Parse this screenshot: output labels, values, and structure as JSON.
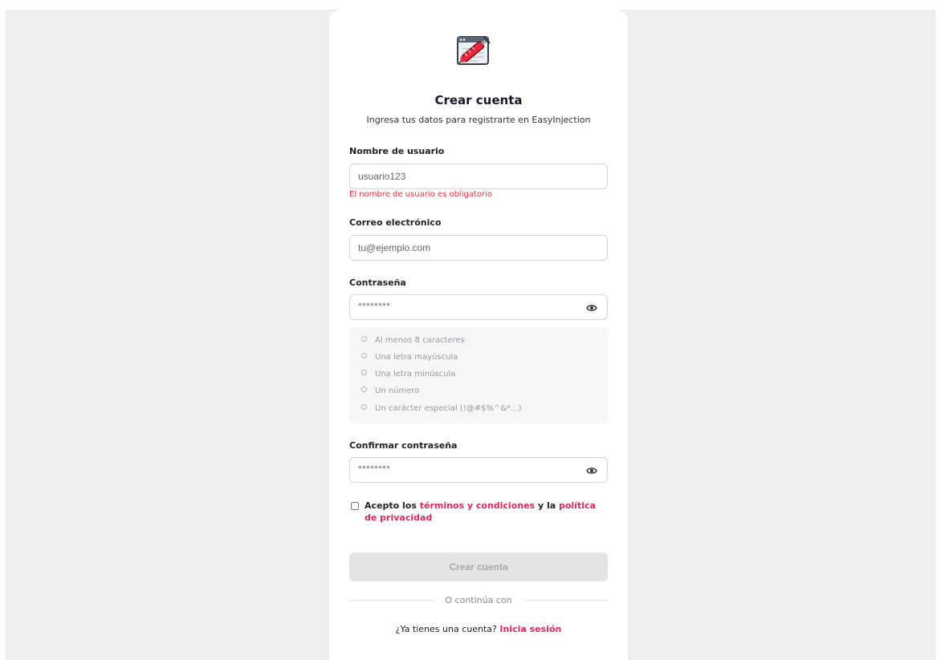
{
  "page": {
    "title": "Crear cuenta",
    "subtitle": "Ingresa tus datos para registrarte en EasyInjection",
    "logo_icon": "syringe-browser-logo"
  },
  "form": {
    "username": {
      "label": "Nombre de usuario",
      "placeholder": "usuario123",
      "error": "El nombre de usuario es obligatorio"
    },
    "email": {
      "label": "Correo electrónico",
      "placeholder": "tu@ejemplo.com"
    },
    "password": {
      "label": "Contraseña",
      "value": "********",
      "toggle_icon": "eye-icon"
    },
    "requirements": [
      "Al menos 8 caracteres",
      "Una letra mayúscula",
      "Una letra minúscula",
      "Un número",
      "Un carácter especial (!@#$%^&*...)"
    ],
    "confirm_password": {
      "label": "Confirmar contraseña",
      "value": "********",
      "toggle_icon": "eye-icon"
    },
    "terms": {
      "prefix": "Acepto los ",
      "terms_link": "términos y condiciones",
      "middle": " y la ",
      "privacy_link": "política de privacidad",
      "checked": false
    },
    "submit_label": "Crear cuenta"
  },
  "footer": {
    "divider_text": "O continúa con",
    "login_prompt": "¿Ya tienes una cuenta? ",
    "login_link": "Inicia sesión"
  },
  "colors": {
    "accent": "#e0275d",
    "error": "#ef3340",
    "background": "#efeeef",
    "disabled_button": "#e4e4e6"
  }
}
